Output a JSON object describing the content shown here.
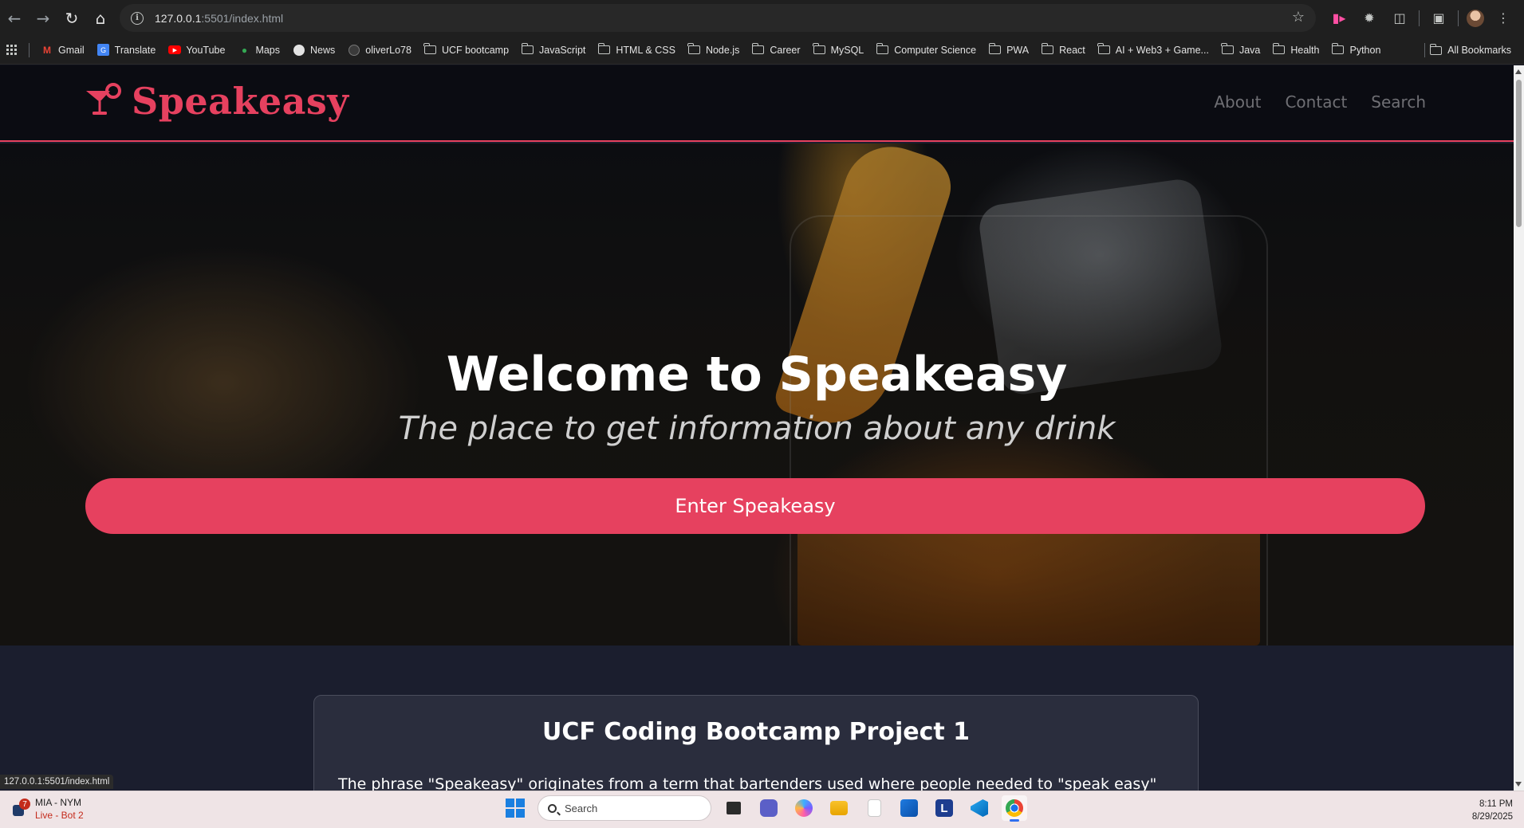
{
  "browser": {
    "url_host": "127.0.0.1",
    "url_path": ":5501/index.html",
    "status_url": "127.0.0.1:5501/index.html",
    "bookmarks": [
      {
        "label": "Gmail",
        "icon": "gmail-icon"
      },
      {
        "label": "Translate",
        "icon": "translate-icon"
      },
      {
        "label": "YouTube",
        "icon": "youtube-icon"
      },
      {
        "label": "Maps",
        "icon": "maps-icon"
      },
      {
        "label": "News",
        "icon": "news-icon"
      },
      {
        "label": "oliverLo78",
        "icon": "github-icon"
      },
      {
        "label": "UCF bootcamp",
        "icon": "folder-icon"
      },
      {
        "label": "JavaScript",
        "icon": "folder-icon"
      },
      {
        "label": "HTML & CSS",
        "icon": "folder-icon"
      },
      {
        "label": "Node.js",
        "icon": "folder-icon"
      },
      {
        "label": "Career",
        "icon": "folder-icon"
      },
      {
        "label": "MySQL",
        "icon": "folder-icon"
      },
      {
        "label": "Computer Science",
        "icon": "folder-icon"
      },
      {
        "label": "PWA",
        "icon": "folder-icon"
      },
      {
        "label": "React",
        "icon": "folder-icon"
      },
      {
        "label": "AI + Web3 + Game...",
        "icon": "folder-icon"
      },
      {
        "label": "Java",
        "icon": "folder-icon"
      },
      {
        "label": "Health",
        "icon": "folder-icon"
      },
      {
        "label": "Python",
        "icon": "folder-icon"
      }
    ],
    "all_bookmarks": "All Bookmarks"
  },
  "site": {
    "brand": "Speakeasy",
    "nav": [
      {
        "label": "About"
      },
      {
        "label": "Contact"
      },
      {
        "label": "Search"
      }
    ],
    "hero": {
      "title": "Welcome to Speakeasy",
      "subtitle": "The place to get information about any drink",
      "button": "Enter Speakeasy"
    },
    "card": {
      "title": "UCF Coding Bootcamp Project 1",
      "body": "The phrase \"Speakeasy\" originates from a term that bartenders used where people needed to \"speak easy\" (quietly)"
    },
    "colors": {
      "accent": "#e6415f",
      "nav_bg": "#0b0c12",
      "page_bg": "#1b1e2e"
    }
  },
  "taskbar": {
    "widget_title": "MIA - NYM",
    "widget_subtitle": "Live - Bot 2",
    "widget_badge": "7",
    "search_placeholder": "Search",
    "time": "8:11 PM",
    "date": "8/29/2025"
  }
}
